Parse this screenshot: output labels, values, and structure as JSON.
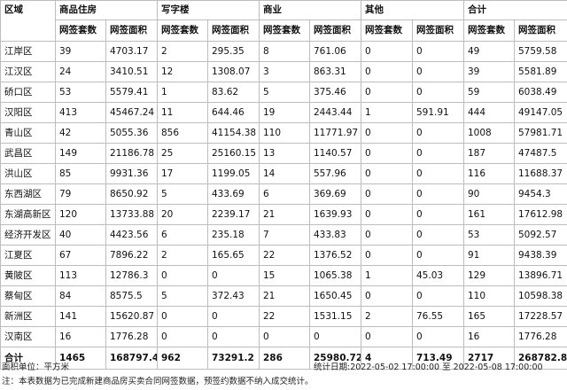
{
  "table": {
    "header": {
      "region": "区域",
      "groups": [
        "商品住房",
        "写字楼",
        "商业",
        "其他",
        "合计"
      ],
      "count_label": "网签套数",
      "area_label": "网签面积"
    },
    "rows": [
      {
        "region": "江岸区",
        "cells": [
          "39",
          "4703.17",
          "2",
          "295.35",
          "8",
          "761.06",
          "0",
          "0",
          "49",
          "5759.58"
        ]
      },
      {
        "region": "江汉区",
        "cells": [
          "24",
          "3410.51",
          "12",
          "1308.07",
          "3",
          "863.31",
          "0",
          "0",
          "39",
          "5581.89"
        ]
      },
      {
        "region": "硚口区",
        "cells": [
          "53",
          "5579.41",
          "1",
          "83.62",
          "5",
          "375.46",
          "0",
          "0",
          "59",
          "6038.49"
        ]
      },
      {
        "region": "汉阳区",
        "cells": [
          "413",
          "45467.24",
          "11",
          "644.46",
          "19",
          "2443.44",
          "1",
          "591.91",
          "444",
          "49147.05"
        ]
      },
      {
        "region": "青山区",
        "cells": [
          "42",
          "5055.36",
          "856",
          "41154.38",
          "110",
          "11771.97",
          "0",
          "0",
          "1008",
          "57981.71"
        ]
      },
      {
        "region": "武昌区",
        "cells": [
          "149",
          "21186.78",
          "25",
          "25160.15",
          "13",
          "1140.57",
          "0",
          "0",
          "187",
          "47487.5"
        ]
      },
      {
        "region": "洪山区",
        "cells": [
          "85",
          "9931.36",
          "17",
          "1199.05",
          "14",
          "557.96",
          "0",
          "0",
          "116",
          "11688.37"
        ]
      },
      {
        "region": "东西湖区",
        "cells": [
          "79",
          "8650.92",
          "5",
          "433.69",
          "6",
          "369.69",
          "0",
          "0",
          "90",
          "9454.3"
        ]
      },
      {
        "region": "东湖高新区",
        "cells": [
          "120",
          "13733.88",
          "20",
          "2239.17",
          "21",
          "1639.93",
          "0",
          "0",
          "161",
          "17612.98"
        ]
      },
      {
        "region": "经济开发区",
        "cells": [
          "40",
          "4423.56",
          "6",
          "235.18",
          "7",
          "433.83",
          "0",
          "0",
          "53",
          "5092.57"
        ]
      },
      {
        "region": "江夏区",
        "cells": [
          "67",
          "7896.22",
          "2",
          "165.65",
          "22",
          "1376.52",
          "0",
          "0",
          "91",
          "9438.39"
        ]
      },
      {
        "region": "黄陂区",
        "cells": [
          "113",
          "12786.3",
          "0",
          "0",
          "15",
          "1065.38",
          "1",
          "45.03",
          "129",
          "13896.71"
        ]
      },
      {
        "region": "蔡甸区",
        "cells": [
          "84",
          "8575.5",
          "5",
          "372.43",
          "21",
          "1650.45",
          "0",
          "0",
          "110",
          "10598.38"
        ]
      },
      {
        "region": "新洲区",
        "cells": [
          "141",
          "15620.87",
          "0",
          "0",
          "22",
          "1531.15",
          "2",
          "76.55",
          "165",
          "17228.57"
        ]
      },
      {
        "region": "汉南区",
        "cells": [
          "16",
          "1776.28",
          "0",
          "0",
          "0",
          "0",
          "0",
          "0",
          "16",
          "1776.28"
        ]
      }
    ],
    "total": {
      "region": "合计",
      "cells": [
        "1465",
        "168797.4",
        "962",
        "73291.2",
        "286",
        "25980.72",
        "4",
        "713.49",
        "2717",
        "268782.8"
      ]
    }
  },
  "footer": {
    "unit_note": "面积单位：平方米",
    "stat_date": "统计日期:2022-05-02   17:00:00 至 2022-05-08 17:00:00",
    "note": "注：本表数据为已完成新建商品房买卖合同网签数据，预签约数据不纳入成交统计。"
  }
}
